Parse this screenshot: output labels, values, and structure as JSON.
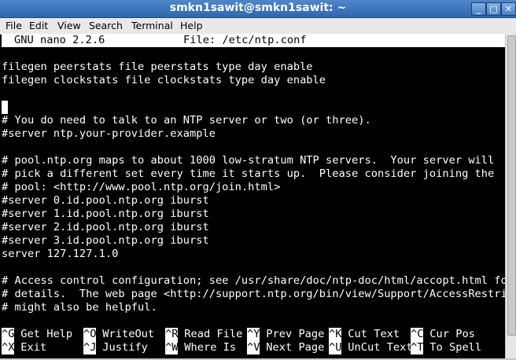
{
  "window": {
    "title": "smkn1sawit@smkn1sawit: ~",
    "buttons": {
      "minimize": "_",
      "maximize": "□",
      "close": "✕"
    }
  },
  "menu": [
    "File",
    "Edit",
    "View",
    "Search",
    "Terminal",
    "Help"
  ],
  "nano": {
    "version": "GNU nano 2.2.6",
    "file": "File: /etc/ntp.conf"
  },
  "content_lines": [
    "",
    "filegen peerstats file peerstats type day enable",
    "filegen clockstats file clockstats type day enable",
    "",
    "",
    "# You do need to talk to an NTP server or two (or three).",
    "#server ntp.your-provider.example",
    "",
    "# pool.ntp.org maps to about 1000 low-stratum NTP servers.  Your server will",
    "# pick a different set every time it starts up.  Please consider joining the",
    "# pool: <http://www.pool.ntp.org/join.html>",
    "#server 0.id.pool.ntp.org iburst",
    "#server 1.id.pool.ntp.org iburst",
    "#server 2.id.pool.ntp.org iburst",
    "#server 3.id.pool.ntp.org iburst",
    "server 127.127.1.0",
    "",
    "# Access control configuration; see /usr/share/doc/ntp-doc/html/accopt.html for",
    "# details.  The web page <http://support.ntp.org/bin/view/Support/AccessRestric$",
    "# might also be helpful.",
    ""
  ],
  "shortcuts": {
    "row1": [
      {
        "key": "^G",
        "label": " Get Help"
      },
      {
        "key": "^O",
        "label": " WriteOut"
      },
      {
        "key": "^R",
        "label": " Read File"
      },
      {
        "key": "^Y",
        "label": " Prev Page"
      },
      {
        "key": "^K",
        "label": " Cut Text"
      },
      {
        "key": "^C",
        "label": " Cur Pos"
      }
    ],
    "row2": [
      {
        "key": "^X",
        "label": " Exit"
      },
      {
        "key": "^J",
        "label": " Justify"
      },
      {
        "key": "^W",
        "label": " Where Is"
      },
      {
        "key": "^V",
        "label": " Next Page"
      },
      {
        "key": "^U",
        "label": " UnCut Text"
      },
      {
        "key": "^T",
        "label": " To Spell"
      }
    ]
  },
  "colors": {
    "titlebar": "#3a72b8",
    "terminal_bg": "#000000",
    "terminal_fg": "#ffffff",
    "highlight_bg": "#ffffff"
  }
}
